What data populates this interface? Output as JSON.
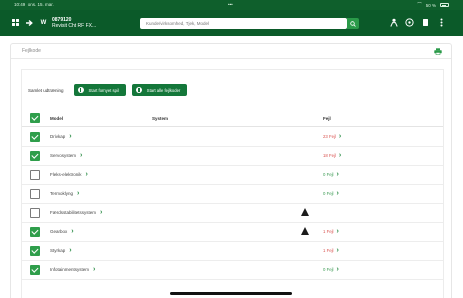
{
  "status_bar": {
    "time": "10:49",
    "date": "ons. 15. mar.",
    "center": "•••",
    "battery_percent": "50 %"
  },
  "toolbar": {
    "menu_icon": "grid-icon",
    "back_icon": "arrow-icon",
    "account_badge": "W",
    "account_id": "0879120",
    "account_name": "Revisit Cht RF FX...",
    "search_placeholder": "Kunde/virksomhed, Tjek, Model",
    "search_icon": "search-icon",
    "right_icons": [
      "person-icon",
      "help-icon",
      "document-icon",
      "menu-dots-icon"
    ]
  },
  "panel": {
    "title": "Fejlkode",
    "print_icon": "printer-icon"
  },
  "actions": {
    "label": "Samlet udtræning",
    "buttons": [
      "Start fornyet spil",
      "Start alle fejlkoder"
    ]
  },
  "table": {
    "headers": {
      "model": "Model",
      "system": "System",
      "fault": "Fejl"
    },
    "rows": [
      {
        "name": "Drivkap",
        "checked": true,
        "warning": false,
        "fault": "23 Fejl",
        "fault_color": "#d9534f"
      },
      {
        "name": "Servosystem",
        "checked": true,
        "warning": false,
        "fault": "18 Fejl",
        "fault_color": "#d9534f"
      },
      {
        "name": "Fleks-elektronik",
        "checked": false,
        "warning": false,
        "fault": "0 Fejl",
        "fault_color": "#3a9a52"
      },
      {
        "name": "Termoklyng",
        "checked": false,
        "warning": false,
        "fault": "0 Fejl",
        "fault_color": "#3a9a52"
      },
      {
        "name": "Færdsstabilitetssystem",
        "checked": false,
        "warning": true,
        "fault": "",
        "fault_color": "#3a9a52"
      },
      {
        "name": "Gearbox",
        "checked": true,
        "warning": true,
        "fault": "1 Fejl",
        "fault_color": "#d9534f"
      },
      {
        "name": "Styrkap",
        "checked": true,
        "warning": false,
        "fault": "1 Fejl",
        "fault_color": "#d9534f"
      },
      {
        "name": "Infotainmentsystem",
        "checked": true,
        "warning": false,
        "fault": "0 Fejl",
        "fault_color": "#3a9a52"
      }
    ]
  },
  "colors": {
    "brand_dark": "#0b5a29",
    "button_green": "#14773a",
    "checkbox_green": "#2f9e4b",
    "error_red": "#d9534f",
    "ok_green": "#3a9a52"
  }
}
